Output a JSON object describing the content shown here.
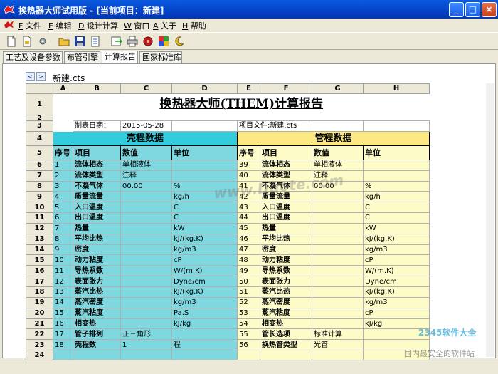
{
  "window": {
    "title": "换热器大师试用版 - [当前项目：新建]",
    "minimize": "_",
    "maximize": "□",
    "close": "×"
  },
  "menu": [
    {
      "key": "F",
      "label": "文件"
    },
    {
      "key": "E",
      "label": "编辑"
    },
    {
      "key": "D",
      "label": "设计计算"
    },
    {
      "key": "W",
      "label": "窗口"
    },
    {
      "key": "A",
      "label": "关于"
    },
    {
      "key": "H",
      "label": "帮助"
    }
  ],
  "tabs": [
    {
      "label": "工艺及设备参数",
      "active": false
    },
    {
      "label": "布管引擎",
      "active": false
    },
    {
      "label": "计算报告",
      "active": true
    },
    {
      "label": "国家标准库",
      "active": false
    }
  ],
  "sheet": {
    "nav_prev": "<",
    "nav_next": ">",
    "tab": "新建.cts"
  },
  "columns": [
    "A",
    "B",
    "C",
    "D",
    "E",
    "F",
    "G",
    "H"
  ],
  "report": {
    "title": "换热器大师(THEM)计算报告",
    "date_label": "制表日期：",
    "date_value": "2015-05-28",
    "file_label": "项目文件:新建.cts",
    "shell_header": "壳程数据",
    "tube_header": "管程数据",
    "col_no": "序号",
    "col_item": "项目",
    "col_value": "数值",
    "col_unit": "单位"
  },
  "rows": [
    {
      "r": "6",
      "a": "1",
      "b": "流体相态",
      "c": "单相液体",
      "d": "",
      "e": "39",
      "f": "流体相态",
      "g": "单相液体",
      "h": ""
    },
    {
      "r": "7",
      "a": "2",
      "b": "流体类型",
      "c": "注释",
      "d": "",
      "e": "40",
      "f": "流体类型",
      "g": "注释",
      "h": ""
    },
    {
      "r": "8",
      "a": "3",
      "b": "不凝气体",
      "c": "00.00",
      "d": "%",
      "e": "41",
      "f": "不凝气体",
      "g": "00.00",
      "h": "%"
    },
    {
      "r": "9",
      "a": "4",
      "b": "质量流量",
      "c": "",
      "d": "kg/h",
      "e": "42",
      "f": "质量流量",
      "g": "",
      "h": "kg/h"
    },
    {
      "r": "10",
      "a": "5",
      "b": "入口温度",
      "c": "",
      "d": "C",
      "e": "43",
      "f": "入口温度",
      "g": "",
      "h": "C"
    },
    {
      "r": "11",
      "a": "6",
      "b": "出口温度",
      "c": "",
      "d": "C",
      "e": "44",
      "f": "出口温度",
      "g": "",
      "h": "C"
    },
    {
      "r": "12",
      "a": "7",
      "b": "热量",
      "c": "",
      "d": "kW",
      "e": "45",
      "f": "热量",
      "g": "",
      "h": "kW"
    },
    {
      "r": "13",
      "a": "8",
      "b": "平均比热",
      "c": "",
      "d": "kJ/(kg.K)",
      "e": "46",
      "f": "平均比热",
      "g": "",
      "h": "kJ/(kg.K)"
    },
    {
      "r": "14",
      "a": "9",
      "b": "密度",
      "c": "",
      "d": "kg/m3",
      "e": "47",
      "f": "密度",
      "g": "",
      "h": "kg/m3"
    },
    {
      "r": "15",
      "a": "10",
      "b": "动力粘度",
      "c": "",
      "d": "cP",
      "e": "48",
      "f": "动力粘度",
      "g": "",
      "h": "cP"
    },
    {
      "r": "16",
      "a": "11",
      "b": "导热系数",
      "c": "",
      "d": "W/(m.K)",
      "e": "49",
      "f": "导热系数",
      "g": "",
      "h": "W/(m.K)"
    },
    {
      "r": "17",
      "a": "12",
      "b": "表面张力",
      "c": "",
      "d": "Dyne/cm",
      "e": "50",
      "f": "表面张力",
      "g": "",
      "h": "Dyne/cm"
    },
    {
      "r": "18",
      "a": "13",
      "b": "蒸汽比热",
      "c": "",
      "d": "kJ/(kg.K)",
      "e": "51",
      "f": "蒸汽比热",
      "g": "",
      "h": "kJ/(kg.K)"
    },
    {
      "r": "19",
      "a": "14",
      "b": "蒸汽密度",
      "c": "",
      "d": "kg/m3",
      "e": "52",
      "f": "蒸汽密度",
      "g": "",
      "h": "kg/m3"
    },
    {
      "r": "20",
      "a": "15",
      "b": "蒸汽粘度",
      "c": "",
      "d": "Pa.S",
      "e": "53",
      "f": "蒸汽粘度",
      "g": "",
      "h": "cP"
    },
    {
      "r": "21",
      "a": "16",
      "b": "相变热",
      "c": "",
      "d": "kJ/kg",
      "e": "54",
      "f": "相变热",
      "g": "",
      "h": "kJ/kg"
    },
    {
      "r": "22",
      "a": "17",
      "b": "管子排列",
      "c": "正三角形",
      "d": "",
      "e": "55",
      "f": "管长选项",
      "g": "标准计算",
      "h": ""
    },
    {
      "r": "23",
      "a": "18",
      "b": "壳程数",
      "c": "1",
      "d": "程",
      "e": "56",
      "f": "换热管类型",
      "g": "光管",
      "h": ""
    }
  ],
  "watermark": "www.Duote.com",
  "watermark2": "2345软件大全",
  "watermark3": "国内最安全的软件站"
}
